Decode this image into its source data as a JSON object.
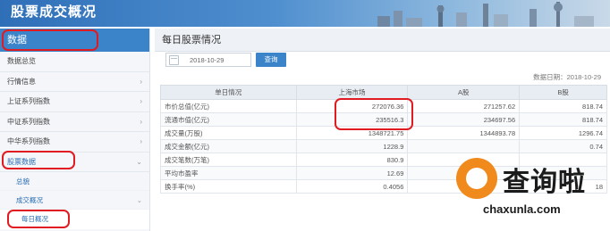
{
  "header": {
    "title": "股票成交概况"
  },
  "sidebar": {
    "head": "数据",
    "items": [
      {
        "label": "数据总览",
        "chev": ""
      },
      {
        "label": "行情信息",
        "chev": "›"
      },
      {
        "label": "上证系列指数",
        "chev": "›"
      },
      {
        "label": "中证系列指数",
        "chev": "›"
      },
      {
        "label": "中华系列指数",
        "chev": "›"
      },
      {
        "label": "股票数据",
        "chev": "⌄"
      }
    ],
    "sub_items": [
      {
        "label": "总貌",
        "chev": ""
      },
      {
        "label": "成交概况",
        "chev": "⌄"
      }
    ],
    "leaf": "每日概况"
  },
  "main": {
    "title": "每日股票情况",
    "date_value": "2018-10-29",
    "query_label": "查询",
    "data_date": "数据日期：2018-10-29",
    "columns": [
      "单日情况",
      "上海市场",
      "A股",
      "B股"
    ],
    "rows": [
      [
        "市价总值(亿元)",
        "272076.36",
        "271257.62",
        "818.74"
      ],
      [
        "流通市值(亿元)",
        "235516.3",
        "234697.56",
        "818.74"
      ],
      [
        "成交量(万股)",
        "1348721.75",
        "1344893.78",
        "1296.74"
      ],
      [
        "成交金额(亿元)",
        "1228.9",
        "",
        "0.74"
      ],
      [
        "成交笔数(万笔)",
        "830.9",
        "",
        ""
      ],
      [
        "平均市盈率",
        "12.69",
        "",
        ""
      ],
      [
        "换手率(%)",
        "0.4056",
        "",
        "18"
      ]
    ]
  },
  "watermark": {
    "text": "查询啦",
    "url": "chaxunla.com"
  },
  "colors": {
    "accent": "#3b84c9",
    "annotation": "#e01b22",
    "brand_orange": "#f08a1c"
  }
}
